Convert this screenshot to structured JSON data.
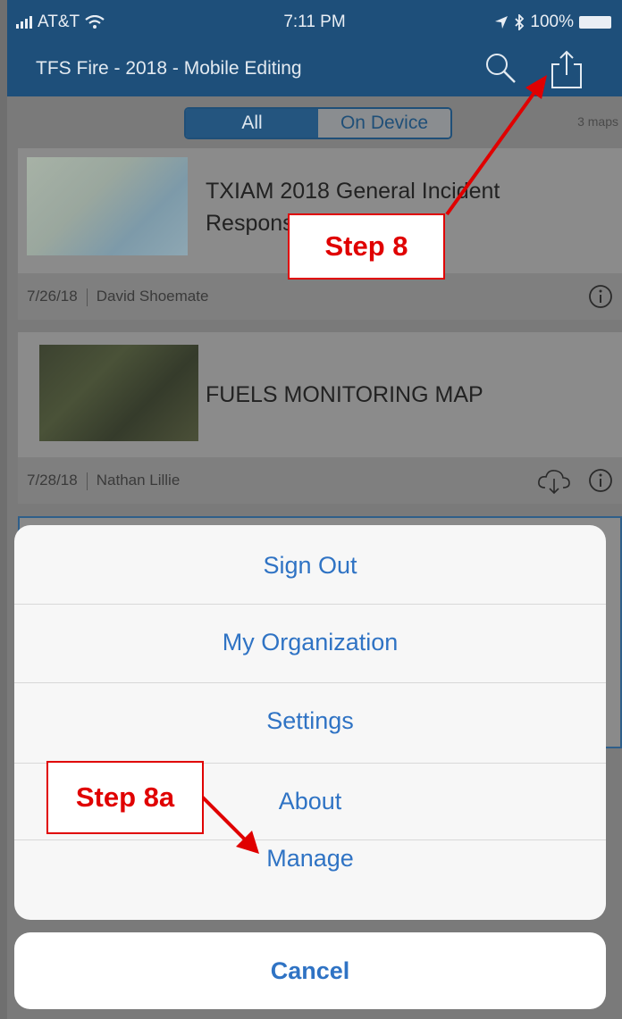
{
  "status_bar": {
    "carrier": "AT&T",
    "time": "7:11 PM",
    "battery": "100%"
  },
  "nav_bar": {
    "title": "TFS Fire - 2018 - Mobile Editing"
  },
  "segments": {
    "all": "All",
    "on_device": "On Device"
  },
  "map_count": "3 maps",
  "maps": [
    {
      "title": "TXIAM 2018 General Incident Response",
      "date": "7/26/18",
      "author": "David Shoemate"
    },
    {
      "title": "FUELS MONITORING MAP",
      "date": "7/28/18",
      "author": "Nathan Lillie"
    }
  ],
  "action_sheet": {
    "items": [
      "Sign Out",
      "My Organization",
      "Settings",
      "About",
      "Manage"
    ],
    "cancel": "Cancel"
  },
  "annotations": {
    "step8": "Step 8",
    "step8a": "Step 8a"
  },
  "colors": {
    "nav_bar": "#1e4f7a",
    "action_text": "#2f73c4",
    "annotation": "#e00000"
  },
  "icons": [
    "wifi-icon",
    "location-icon",
    "bluetooth-icon",
    "search-icon",
    "share-icon",
    "info-icon",
    "cloud-download-icon"
  ]
}
